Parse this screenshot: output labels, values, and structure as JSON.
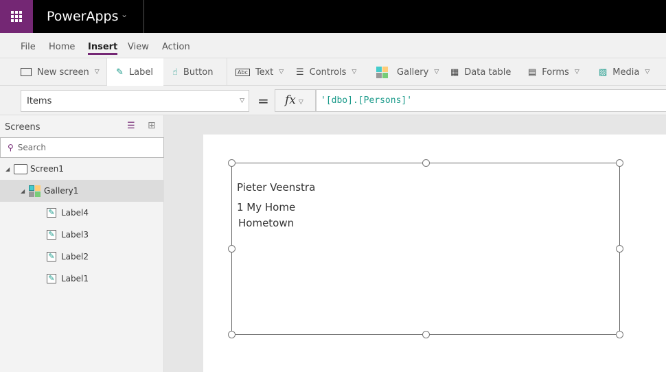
{
  "app": {
    "title": "PowerApps"
  },
  "menu": [
    "File",
    "Home",
    "Insert",
    "View",
    "Action"
  ],
  "menu_active": "Insert",
  "ribbon": {
    "new_screen": "New screen",
    "label": "Label",
    "button": "Button",
    "text": "Text",
    "controls": "Controls",
    "gallery": "Gallery",
    "data_table": "Data table",
    "forms": "Forms",
    "media": "Media"
  },
  "formula": {
    "property": "Items",
    "equals": "=",
    "fx": "fx",
    "value": "'[dbo].[Persons]'"
  },
  "panel": {
    "title": "Screens",
    "search_placeholder": "Search",
    "tree": [
      {
        "label": "Screen1",
        "type": "screen"
      },
      {
        "label": "Gallery1",
        "type": "gallery",
        "selected": true
      },
      {
        "label": "Label4",
        "type": "label"
      },
      {
        "label": "Label3",
        "type": "label"
      },
      {
        "label": "Label2",
        "type": "label"
      },
      {
        "label": "Label1",
        "type": "label"
      }
    ]
  },
  "gallery": {
    "name": "Pieter  Veenstra",
    "address": "1 My Home",
    "city": "Hometown"
  },
  "colors": {
    "brand": "#742774",
    "formula_text": "#1a9a8a"
  }
}
